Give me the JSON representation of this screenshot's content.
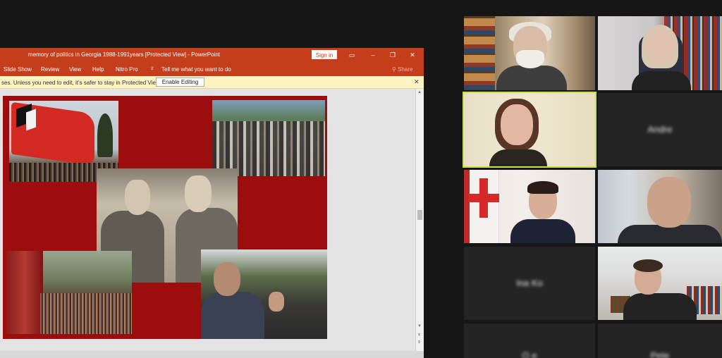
{
  "powerpoint": {
    "window_title": "memory of politics in Georgia 1988-1991years [Protected View] - PowerPoint",
    "sign_in": "Sign in",
    "ribbon_tabs": [
      "Slide Show",
      "Review",
      "View",
      "Help",
      "Nitro Pro"
    ],
    "tell_me": "Tell me what you want to do",
    "share": "Share",
    "protected_message": "ses. Unless you need to edit, it's safer to stay in Protected View.",
    "enable_editing": "Enable Editing",
    "accent_color": "#c43e1c",
    "slide_bg_color": "#9c0e0e"
  },
  "zoom": {
    "participants": [
      {
        "label": ""
      },
      {
        "label": ""
      },
      {
        "label": ""
      },
      {
        "label": "Andre"
      },
      {
        "label": ""
      },
      {
        "label": ""
      },
      {
        "label": "Ina Ko"
      },
      {
        "label": ""
      },
      {
        "label": "O e"
      },
      {
        "label": "Pete"
      }
    ],
    "active_speaker_color": "#c9e24a"
  }
}
